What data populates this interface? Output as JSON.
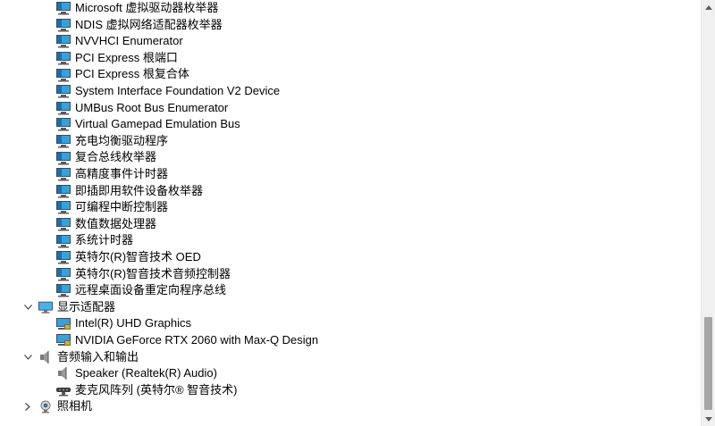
{
  "tree": {
    "system_devices_children": [
      "Microsoft 虚拟驱动器枚举器",
      "NDIS 虚拟网络适配器枚举器",
      "NVVHCI Enumerator",
      "PCI Express 根端口",
      "PCI Express 根复合体",
      "System Interface Foundation V2 Device",
      "UMBus Root Bus Enumerator",
      "Virtual Gamepad Emulation Bus",
      "充电均衡驱动程序",
      "复合总线枚举器",
      "高精度事件计时器",
      "即插即用软件设备枚举器",
      "可编程中断控制器",
      "数值数据处理器",
      "系统计时器",
      "英特尔(R)智音技术 OED",
      "英特尔(R)智音技术音频控制器",
      "远程桌面设备重定向程序总线"
    ],
    "display_adapters": {
      "label": "显示适配器",
      "children": [
        "Intel(R) UHD Graphics",
        "NVIDIA GeForce RTX 2060 with Max-Q Design"
      ]
    },
    "audio_io": {
      "label": "音频输入和输出",
      "children": [
        "Speaker (Realtek(R) Audio)",
        "麦克风阵列 (英特尔® 智音技术)"
      ]
    },
    "cameras": {
      "label": "照相机"
    }
  },
  "icons": {
    "system_device": "system-device-icon",
    "display_category": "monitor-icon",
    "display_device": "display-adapter-icon",
    "audio_category": "speaker-icon",
    "speaker_device": "speaker-icon",
    "microphone_device": "microphone-array-icon",
    "camera_category": "camera-icon"
  },
  "colors": {
    "monitor_screen": "#3aa0d8",
    "monitor_frame": "#2f4f6f",
    "text": "#000000"
  }
}
